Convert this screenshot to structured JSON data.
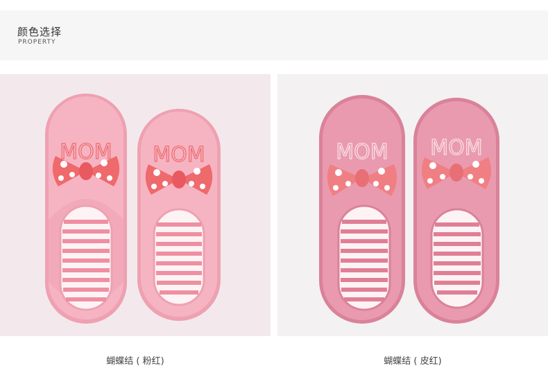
{
  "header": {
    "title": "颜色选择",
    "subtitle": "PROPERTY"
  },
  "products": [
    {
      "caption": "蝴蝶结 ( 粉红)",
      "embroidery": "MOM",
      "colors": {
        "background": "#f3e9ed",
        "upper": "#f6b4c2",
        "upper_dark": "#eea1b1",
        "bow": "#ee6a6c",
        "stripe": "#ef8fa2"
      }
    },
    {
      "caption": "蝴蝶结 ( 皮红)",
      "embroidery": "MOM",
      "colors": {
        "background": "#f4f1f3",
        "upper": "#e99aae",
        "upper_dark": "#d98299",
        "bow": "#f07f84",
        "stripe": "#df7f95"
      }
    }
  ]
}
